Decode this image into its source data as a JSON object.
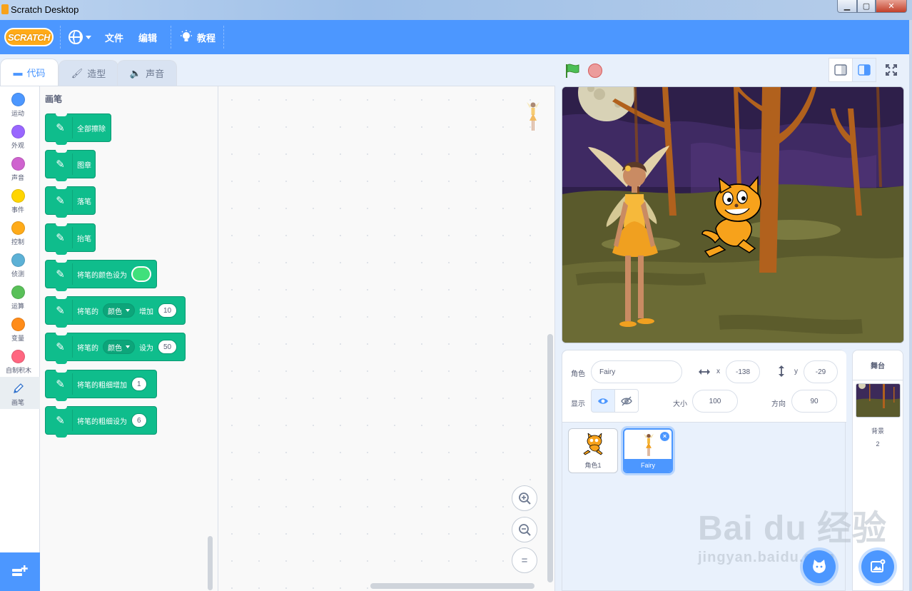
{
  "window": {
    "title": "Scratch Desktop",
    "min": "▁",
    "max": "▢",
    "close": "✕"
  },
  "menubar": {
    "logo": "SCRATCH",
    "file": "文件",
    "edit": "编辑",
    "tutorials": "教程"
  },
  "tabs": {
    "code": "代码",
    "costumes": "造型",
    "sounds": "声音"
  },
  "categories": [
    {
      "label": "运动",
      "color": "#4c97ff"
    },
    {
      "label": "外观",
      "color": "#9966ff"
    },
    {
      "label": "声音",
      "color": "#cf63cf"
    },
    {
      "label": "事件",
      "color": "#ffd500"
    },
    {
      "label": "控制",
      "color": "#ffab19"
    },
    {
      "label": "侦测",
      "color": "#5cb1d6"
    },
    {
      "label": "运算",
      "color": "#59c059"
    },
    {
      "label": "变量",
      "color": "#ff8c1a"
    },
    {
      "label": "自制积木",
      "color": "#ff6680"
    },
    {
      "label": "画笔",
      "color": "#0fbd8c"
    }
  ],
  "palette": {
    "title": "画笔",
    "blocks": {
      "clear": "全部擦除",
      "stamp": "图章",
      "pen_down": "落笔",
      "pen_up": "抬笔",
      "set_color_to": "将笔的颜色设为",
      "change_param_prefix": "将笔的",
      "change_param_menu": "颜色",
      "change_param_suffix": "增加",
      "change_param_value": "10",
      "set_param_prefix": "将笔的",
      "set_param_menu": "颜色",
      "set_param_suffix": "设为",
      "set_param_value": "50",
      "change_size": "将笔的粗细增加",
      "change_size_value": "1",
      "set_size": "将笔的粗细设为",
      "set_size_value": "6"
    }
  },
  "zoom": {
    "in": "+",
    "out": "−",
    "reset": "="
  },
  "sprite_info": {
    "sprite_label": "角色",
    "sprite_name": "Fairy",
    "x_label": "x",
    "x_value": "-138",
    "y_label": "y",
    "y_value": "-29",
    "show_label": "显示",
    "size_label": "大小",
    "size_value": "100",
    "direction_label": "方向",
    "direction_value": "90"
  },
  "sprites": [
    {
      "name": "角色1"
    },
    {
      "name": "Fairy",
      "selected": true
    }
  ],
  "stage_pane": {
    "title": "舞台",
    "backdrops_label": "背景",
    "backdrops_count": "2"
  },
  "watermark": {
    "main": "Bai du 经验",
    "sub": "jingyan.baidu.com"
  },
  "colors": {
    "accent": "#4c97ff",
    "pen": "#0fbd8c",
    "pen_swatch": "#40e07b"
  }
}
